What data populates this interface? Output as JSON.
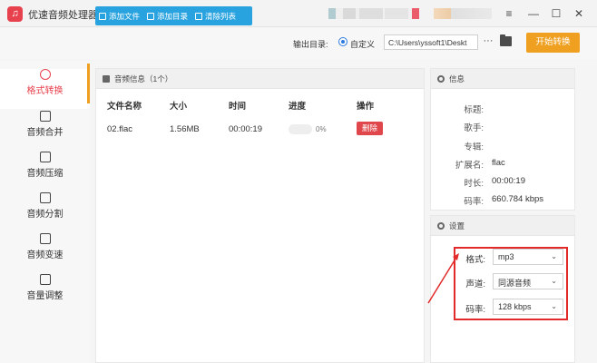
{
  "window": {
    "title": "优速音频处理器",
    "logo_char": "♫",
    "minimize": "—",
    "restore": "☐",
    "close": "✕",
    "menu": "≡"
  },
  "toolbar": {
    "add_file": "添加文件",
    "add_dir": "添加目录",
    "clear_list": "清除列表",
    "output_label": "输出目录:",
    "custom_label": "自定义",
    "path_value": "C:\\Users\\yssoft1\\Deskt",
    "more": "···",
    "start": "开始转换"
  },
  "sidebar": {
    "items": [
      {
        "label": "格式转换",
        "icon": "format-icon",
        "active": true
      },
      {
        "label": "音频合并",
        "icon": "merge-icon"
      },
      {
        "label": "音频压缩",
        "icon": "compress-icon"
      },
      {
        "label": "音频分割",
        "icon": "split-icon"
      },
      {
        "label": "音频变速",
        "icon": "speed-icon"
      },
      {
        "label": "音量调整",
        "icon": "volume-icon"
      }
    ]
  },
  "file_panel": {
    "header": "音频信息（1个）",
    "columns": [
      "文件名称",
      "大小",
      "时间",
      "进度",
      "操作"
    ],
    "rows": [
      {
        "name": "02.flac",
        "size": "1.56MB",
        "time": "00:00:19",
        "progress": "0%",
        "action": "删除"
      }
    ]
  },
  "info_panel": {
    "header": "信息",
    "rows": [
      {
        "label": "标题:",
        "value": ""
      },
      {
        "label": "歌手:",
        "value": ""
      },
      {
        "label": "专辑:",
        "value": ""
      },
      {
        "label": "扩展名:",
        "value": "flac"
      },
      {
        "label": "时长:",
        "value": "00:00:19"
      },
      {
        "label": "码率:",
        "value": "660.784 kbps"
      }
    ]
  },
  "settings_panel": {
    "header": "设置",
    "rows": [
      {
        "label": "格式:",
        "value": "mp3"
      },
      {
        "label": "声道:",
        "value": "同源音频"
      },
      {
        "label": "码率:",
        "value": "128 kbps"
      }
    ]
  },
  "colors": {
    "accent_blue": "#29a3df",
    "start_orange": "#f0a020",
    "active_red": "#e8414e",
    "highlight_box": "#e22a2a"
  }
}
